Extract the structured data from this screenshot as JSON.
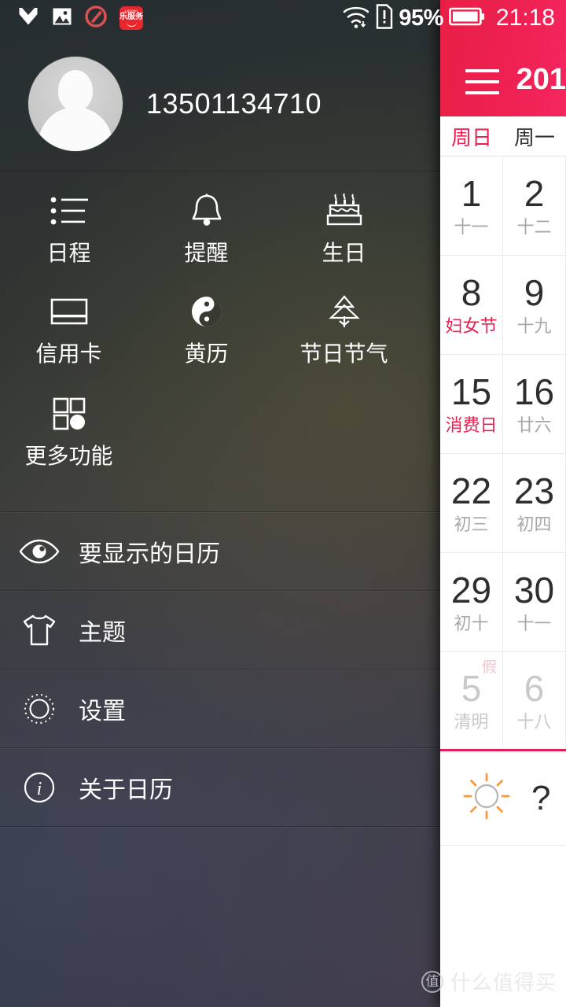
{
  "statusbar": {
    "icons": [
      "shield-icon",
      "gallery-icon",
      "edit-circle-icon",
      "lenovo-service-icon"
    ],
    "lenovo_badge": {
      "brand": "Lenovo",
      "label": "乐服务"
    },
    "wifi_icon": "wifi-icon",
    "sim_alert_icon": "sim-alert-icon",
    "battery_percent": "95%",
    "battery_icon": "battery-icon",
    "clock": "21:18"
  },
  "drawer": {
    "profile": {
      "avatar_icon": "avatar-placeholder-icon",
      "phone": "13501134710"
    },
    "grid": [
      [
        {
          "icon": "list-icon",
          "label": "日程"
        },
        {
          "icon": "bell-icon",
          "label": "提醒"
        },
        {
          "icon": "birthday-cake-icon",
          "label": "生日"
        }
      ],
      [
        {
          "icon": "credit-card-icon",
          "label": "信用卡"
        },
        {
          "icon": "yin-yang-icon",
          "label": "黄历"
        },
        {
          "icon": "pine-tree-icon",
          "label": "节日节气"
        }
      ],
      [
        {
          "icon": "grid-apps-icon",
          "label": "更多功能"
        }
      ]
    ],
    "list": [
      {
        "icon": "eye-icon",
        "label": "要显示的日历"
      },
      {
        "icon": "tshirt-icon",
        "label": "主题"
      },
      {
        "icon": "gear-icon",
        "label": "设置"
      },
      {
        "icon": "info-icon",
        "label": "关于日历"
      }
    ]
  },
  "calendar": {
    "menu_icon": "hamburger-menu-icon",
    "title": "201",
    "accent_color": "#ec1f50",
    "weekdays": [
      {
        "label": "周日",
        "weekend": true
      },
      {
        "label": "周一",
        "weekend": false
      }
    ],
    "weeks": [
      [
        {
          "num": "1",
          "sub": "十一",
          "festival": false,
          "out": false
        },
        {
          "num": "2",
          "sub": "十二",
          "festival": false,
          "out": false
        }
      ],
      [
        {
          "num": "8",
          "sub": "妇女节",
          "festival": true,
          "out": false
        },
        {
          "num": "9",
          "sub": "十九",
          "festival": false,
          "out": false
        }
      ],
      [
        {
          "num": "15",
          "sub": "消费日",
          "festival": true,
          "out": false
        },
        {
          "num": "16",
          "sub": "廿六",
          "festival": false,
          "out": false
        }
      ],
      [
        {
          "num": "22",
          "sub": "初三",
          "festival": false,
          "out": false
        },
        {
          "num": "23",
          "sub": "初四",
          "festival": false,
          "out": false
        }
      ],
      [
        {
          "num": "29",
          "sub": "初十",
          "festival": false,
          "out": false
        },
        {
          "num": "30",
          "sub": "十一",
          "festival": false,
          "out": false
        }
      ],
      [
        {
          "num": "5",
          "sub": "清明",
          "festival": false,
          "out": true,
          "badge": "假"
        },
        {
          "num": "6",
          "sub": "十八",
          "festival": false,
          "out": true
        }
      ]
    ],
    "weather": {
      "icon": "sun-icon",
      "value": "?"
    }
  },
  "watermark": {
    "logo": "值",
    "text": "什么值得买"
  }
}
